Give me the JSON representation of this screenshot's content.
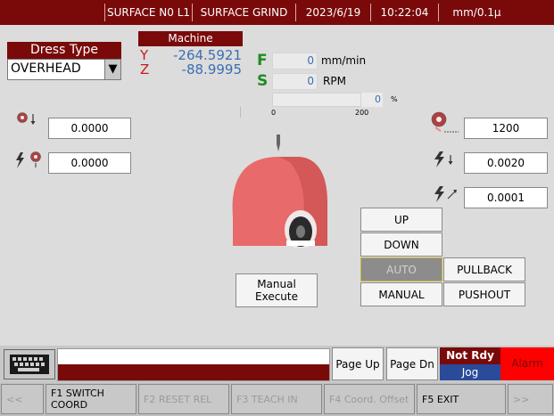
{
  "header": {
    "program": "SURFACE N0 L1",
    "mode": "SURFACE GRIND",
    "date": "2023/6/19",
    "time": "10:22:04",
    "unit": "mm/0.1μ"
  },
  "dress": {
    "title": "Dress Type",
    "value": "OVERHEAD",
    "arrow": "▼"
  },
  "machine": {
    "title": "Machine",
    "y_label": "Y",
    "y_value": "-264.5921",
    "z_label": "Z",
    "z_value": "-88.9995"
  },
  "feed": {
    "f_label": "F",
    "f_value": "0",
    "f_unit": "mm/min",
    "s_label": "S",
    "s_value": "0",
    "s_unit": "RPM"
  },
  "load": {
    "value": "0",
    "unit": "%",
    "min": "0",
    "max": "200",
    "fraction": 0
  },
  "left_params": [
    {
      "icon": "wheel-down-icon",
      "value": "0.0000"
    },
    {
      "icon": "spark-wheel-icon",
      "value": "0.0000"
    }
  ],
  "right_params": [
    {
      "icon": "wheel-speed-icon",
      "value": "1200"
    },
    {
      "icon": "spark-feed-icon",
      "value": "0.0020"
    },
    {
      "icon": "spark-fine-icon",
      "value": "0.0001"
    }
  ],
  "buttons": {
    "up": "UP",
    "down": "DOWN",
    "auto": "AUTO",
    "pullback": "PULLBACK",
    "manual": "MANUAL",
    "pushout": "PUSHOUT",
    "manual_execute": "Manual Execute",
    "page_up": "Page Up",
    "page_dn": "Page Dn"
  },
  "status": {
    "ready": "Not Rdy",
    "mode": "Jog",
    "alarm": "Alarm"
  },
  "function_keys": {
    "prev": "<<",
    "f1_line1": "F1 SWITCH",
    "f1_line2": "COORD",
    "f2": "F2 RESET REL",
    "f3": "F3 TEACH IN",
    "f4": "F4 Coord. Offset",
    "f5": "F5 EXIT",
    "next": ">>"
  },
  "colors": {
    "header_bg": "#7a0a0a",
    "wheel": "#e86a6a",
    "value_blue": "#3b6fb0",
    "axis_red": "#c81c1c",
    "alarm": "#ff0000"
  }
}
